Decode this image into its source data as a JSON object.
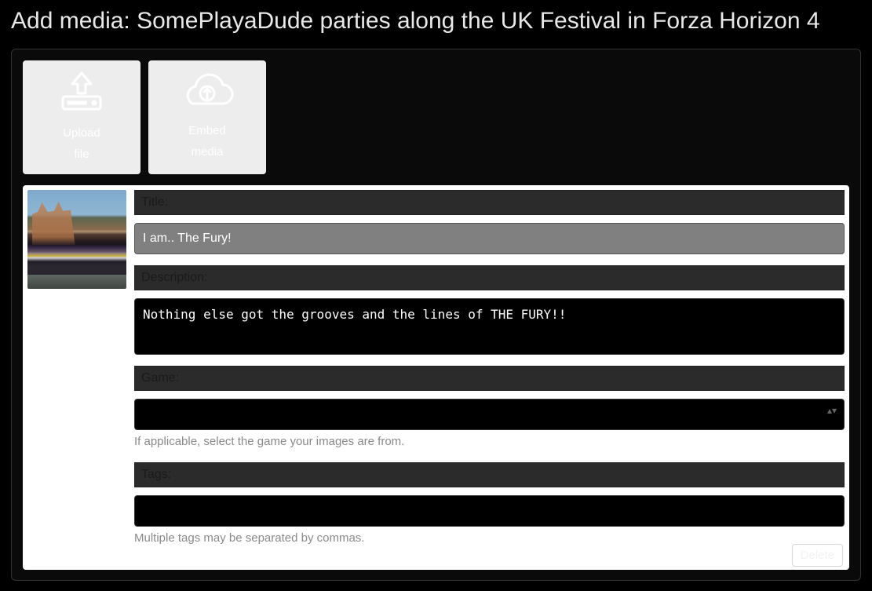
{
  "page": {
    "title": "Add media: SomePlayaDude parties along the UK Festival in Forza Horizon 4"
  },
  "upload": {
    "upload_file_line1": "Upload",
    "upload_file_line2": "file",
    "embed_line1": "Embed",
    "embed_line2": "media"
  },
  "form": {
    "title_label": "Title:",
    "title_value": "I am.. The Fury!",
    "description_label": "Description:",
    "description_value": "Nothing else got the grooves and the lines of THE FURY!!",
    "game_label": "Game:",
    "game_value": "",
    "game_help": "If applicable, select the game your images are from.",
    "tags_label": "Tags:",
    "tags_value": "",
    "tags_help": "Multiple tags may be separated by commas."
  },
  "buttons": {
    "delete": "Delete"
  }
}
